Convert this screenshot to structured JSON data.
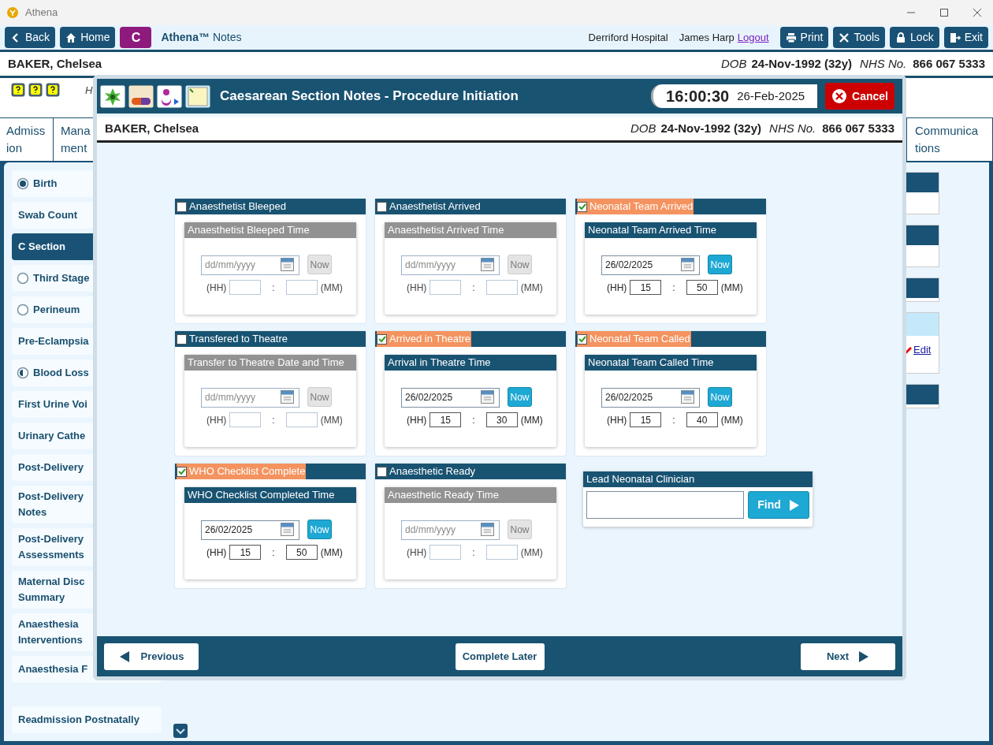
{
  "window": {
    "title": "Athena"
  },
  "toolbar": {
    "left_buttons": [
      {
        "kind": "back",
        "label": "Back"
      },
      {
        "kind": "home",
        "label": "Home"
      },
      {
        "kind": "letter",
        "label": "C"
      }
    ],
    "app_name": "Athena™",
    "app_subtitle": "Notes",
    "hospital": "Derriford Hospital",
    "user": "James Harp",
    "logout": "Logout",
    "right_buttons": [
      {
        "kind": "print",
        "label": "Print"
      },
      {
        "kind": "tools",
        "label": "Tools"
      },
      {
        "kind": "lock",
        "label": "Lock"
      },
      {
        "kind": "exit",
        "label": "Exit"
      }
    ]
  },
  "patient_banner": {
    "name": "BAKER, Chelsea",
    "dob_label": "DOB",
    "dob": "24-Nov-1992 (32y)",
    "nhs_label": "NHS No.",
    "nhs": "866 067 5333"
  },
  "help_row": {
    "text": "H"
  },
  "tabs": [
    {
      "lines": [
        "Admiss",
        "ion"
      ]
    },
    {
      "lines": [
        "Mana",
        "ment"
      ]
    },
    {
      "lines": [
        "Communica",
        "tions"
      ]
    }
  ],
  "sidebar": {
    "items": [
      {
        "label": "Birth",
        "kind": "radio_filled",
        "selected": false
      },
      {
        "label": "Swab Count",
        "kind": "plain",
        "selected": false
      },
      {
        "label": "C Section",
        "kind": "plain",
        "selected": true
      },
      {
        "label": "Third Stage",
        "kind": "radio_empty",
        "selected": false
      },
      {
        "label": "Perineum",
        "kind": "radio_empty",
        "selected": false
      },
      {
        "label": "Pre-Eclampsia",
        "kind": "plain",
        "selected": false
      },
      {
        "label": "Blood Loss",
        "kind": "radio_half",
        "selected": false
      },
      {
        "label": "First Urine Voi",
        "kind": "plain",
        "selected": false
      },
      {
        "label": "Urinary Cathe",
        "kind": "plain",
        "selected": false
      },
      {
        "label": "Post-Delivery",
        "kind": "plain",
        "selected": false
      },
      {
        "label": "Post-Delivery Notes",
        "kind": "plain",
        "selected": false
      },
      {
        "label": "Post-Delivery Assessments",
        "kind": "plain",
        "selected": false
      },
      {
        "label": "Maternal Disc Summary",
        "kind": "plain",
        "selected": false
      },
      {
        "label": "Anaesthesia Interventions",
        "kind": "plain",
        "selected": false
      },
      {
        "label": "Anaesthesia F",
        "kind": "plain",
        "selected": false
      },
      {
        "label": "Readmission Postnatally",
        "kind": "plain",
        "selected": false
      }
    ]
  },
  "right_panels": [
    {
      "kind": "header"
    },
    {
      "kind": "header"
    },
    {
      "kind": "header_short"
    },
    {
      "kind": "edit",
      "edit_link": "Edit"
    },
    {
      "kind": "header_short"
    }
  ],
  "modal": {
    "title": "Caesarean Section Notes - Procedure Initiation",
    "clock": {
      "time": "16:00:30",
      "date": "26-Feb-2025"
    },
    "cancel": "Cancel",
    "patient": {
      "name": "BAKER, Chelsea",
      "dob_label": "DOB",
      "dob": "24-Nov-1992 (32y)",
      "nhs_label": "NHS No.",
      "nhs": "866 067 5333"
    },
    "panels": [
      {
        "label": "Anaesthetist Bleeped",
        "checked": false,
        "sub_title": "Anaesthetist Bleeped Time",
        "date_placeholder": "dd/mm/yyyy",
        "now": "Now",
        "hh_label": "(HH)",
        "separator": ":",
        "mm_label": "(MM)"
      },
      {
        "label": "Anaesthetist Arrived",
        "checked": false,
        "sub_title": "Anaesthetist Arrived Time",
        "date_placeholder": "dd/mm/yyyy",
        "now": "Now",
        "hh_label": "(HH)",
        "separator": ":",
        "mm_label": "(MM)"
      },
      {
        "label": "Neonatal Team Arrived",
        "checked": true,
        "sub_title": "Neonatal Team Arrived Time",
        "date": "26/02/2025",
        "now": "Now",
        "hh_label": "(HH)",
        "hh": "15",
        "separator": ":",
        "mm": "50",
        "mm_label": "(MM)"
      },
      {
        "label": "Transfered to Theatre",
        "checked": false,
        "sub_title": "Transfer to Theatre Date and Time",
        "date_placeholder": "dd/mm/yyyy",
        "now": "Now",
        "hh_label": "(HH)",
        "separator": ":",
        "mm_label": "(MM)"
      },
      {
        "label": "Arrived in Theatre",
        "checked": true,
        "sub_title": "Arrival in Theatre Time",
        "date": "26/02/2025",
        "now": "Now",
        "hh_label": "(HH)",
        "hh": "15",
        "separator": ":",
        "mm": "30",
        "mm_label": "(MM)"
      },
      {
        "label": "Neonatal Team Called",
        "checked": true,
        "sub_title": "Neonatal Team Called Time",
        "date": "26/02/2025",
        "now": "Now",
        "hh_label": "(HH)",
        "hh": "15",
        "separator": ":",
        "mm": "40",
        "mm_label": "(MM)"
      },
      {
        "label": "WHO Checklist Complete",
        "checked": true,
        "sub_title": "WHO Checklist Completed Time",
        "date": "26/02/2025",
        "now": "Now",
        "hh_label": "(HH)",
        "hh": "15",
        "separator": ":",
        "mm": "50",
        "mm_label": "(MM)"
      },
      {
        "label": "Anaesthetic Ready",
        "checked": false,
        "sub_title": "Anaesthetic Ready Time",
        "date_placeholder": "dd/mm/yyyy",
        "now": "Now",
        "hh_label": "(HH)",
        "separator": ":",
        "mm_label": "(MM)"
      }
    ],
    "lead": {
      "title": "Lead Neonatal Clinician",
      "find": "Find"
    },
    "footer": {
      "previous": "Previous",
      "complete_later": "Complete Later",
      "next": "Next"
    }
  }
}
